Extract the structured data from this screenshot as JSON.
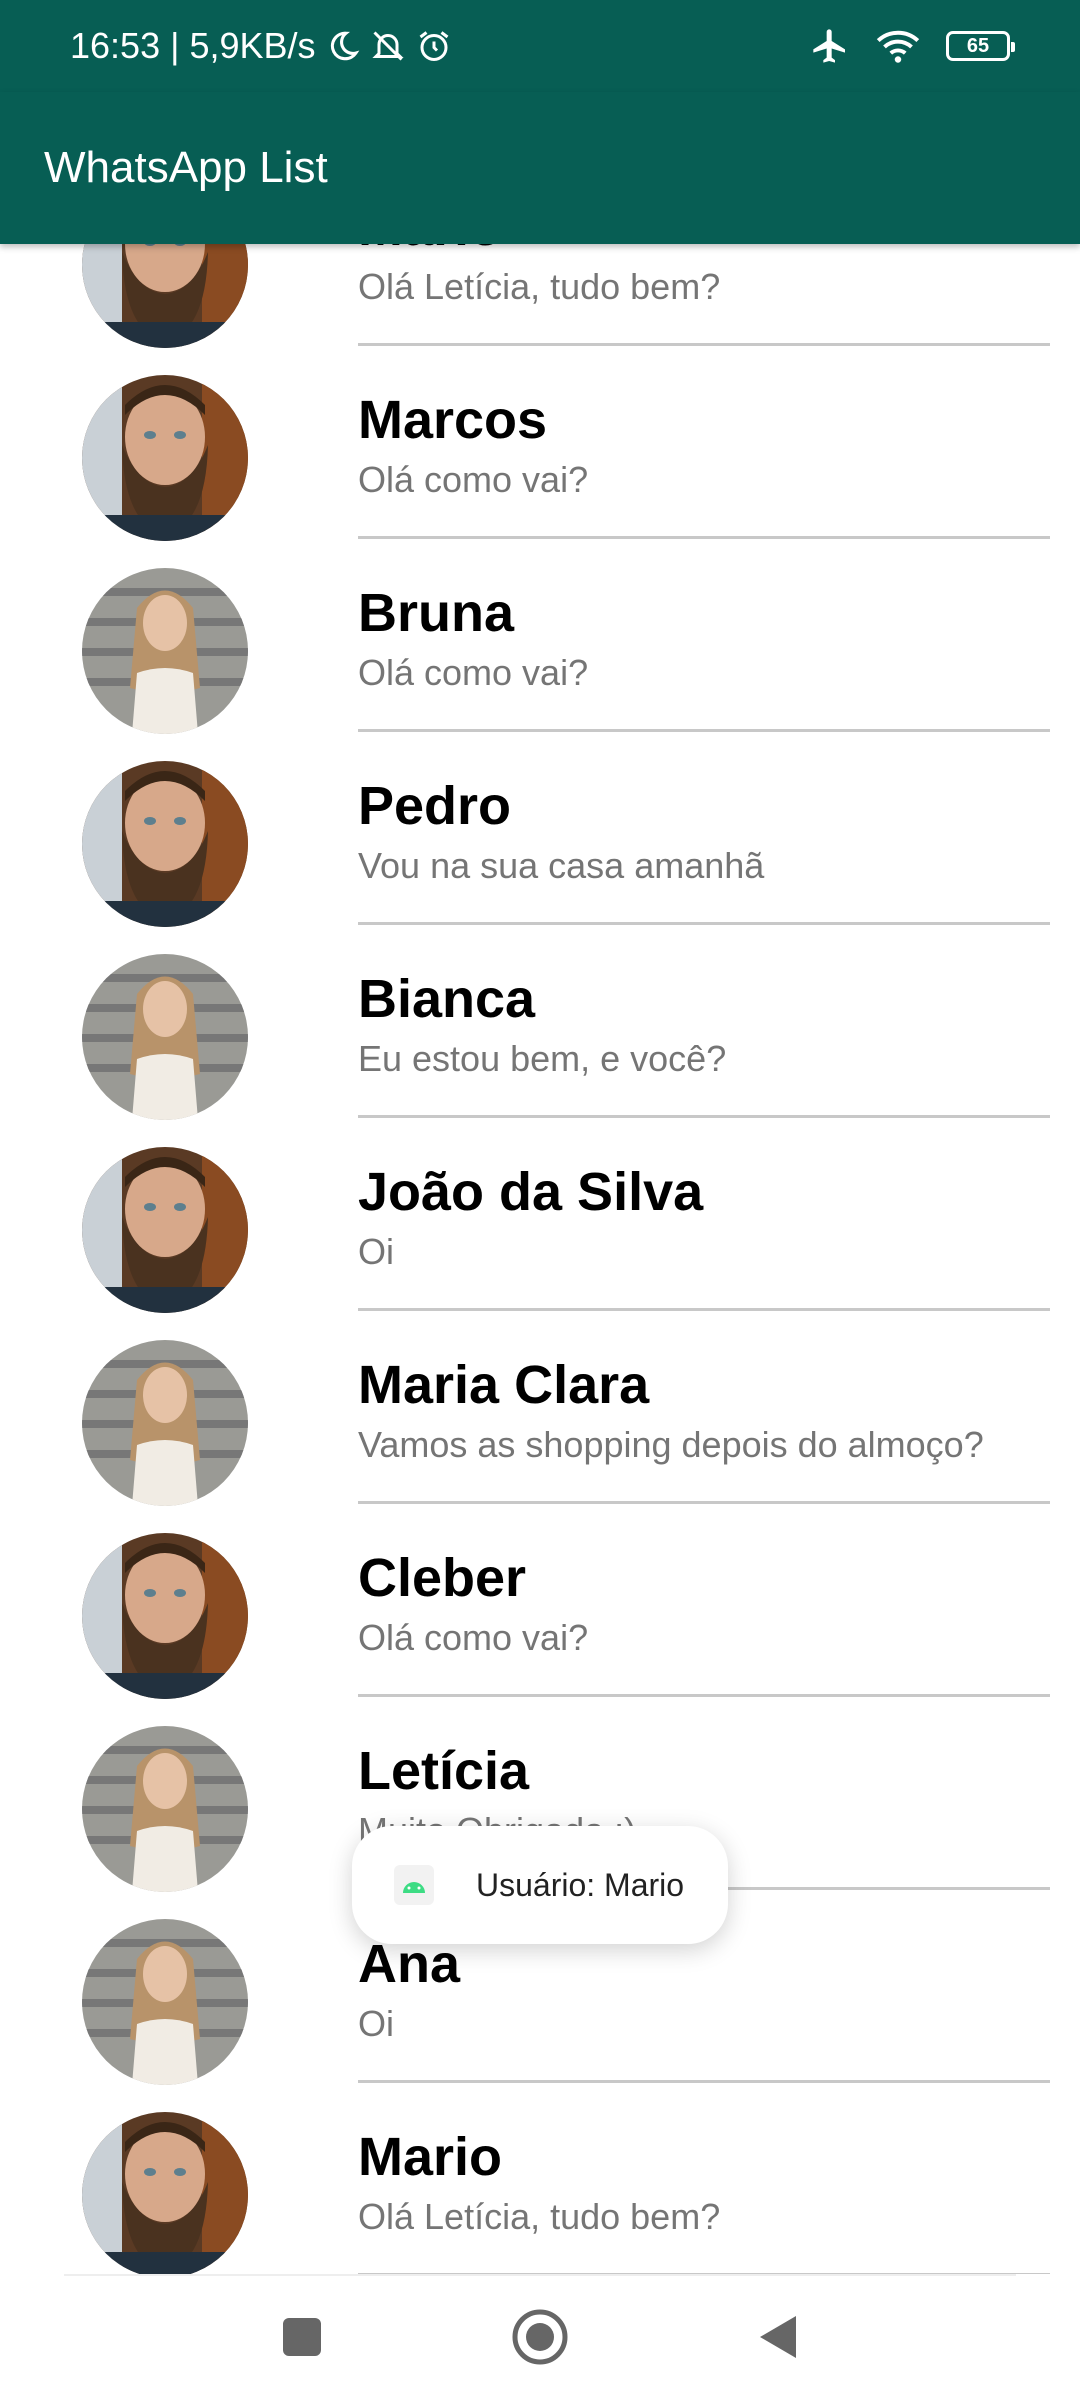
{
  "status_bar": {
    "left_text": "16:53 | 5,9KB/s",
    "battery": "65",
    "icons": [
      "moon-icon",
      "bell-off-icon",
      "alarm-icon",
      "airplane-icon",
      "wifi-icon",
      "battery-icon"
    ]
  },
  "app_bar": {
    "title": "WhatsApp List"
  },
  "contacts": [
    {
      "name": "Mario",
      "message": "Olá Letícia, tudo bem?",
      "avatar": "man"
    },
    {
      "name": "Marcos",
      "message": "Olá como vai?",
      "avatar": "man"
    },
    {
      "name": "Bruna",
      "message": "Olá como vai?",
      "avatar": "woman"
    },
    {
      "name": "Pedro",
      "message": "Vou na sua casa amanhã",
      "avatar": "man"
    },
    {
      "name": "Bianca",
      "message": "Eu estou bem, e você?",
      "avatar": "woman"
    },
    {
      "name": "João da Silva",
      "message": "Oi",
      "avatar": "man"
    },
    {
      "name": "Maria Clara",
      "message": "Vamos as shopping depois do almoço?",
      "avatar": "woman"
    },
    {
      "name": "Cleber",
      "message": "Olá como vai?",
      "avatar": "man"
    },
    {
      "name": "Letícia",
      "message": "Muito Obrigada :)",
      "avatar": "woman"
    },
    {
      "name": "Ana",
      "message": "Oi",
      "avatar": "woman"
    },
    {
      "name": "Mario",
      "message": "Olá Letícia, tudo bem?",
      "avatar": "man"
    }
  ],
  "toast": {
    "text": "Usuário: Mario",
    "icon": "android-icon"
  },
  "nav_bar": {
    "icons": [
      "recents-square-icon",
      "home-circle-icon",
      "back-triangle-icon"
    ]
  },
  "colors": {
    "primary": "#075e54",
    "secondary_text": "#757575",
    "divider": "#c8c8c8"
  }
}
